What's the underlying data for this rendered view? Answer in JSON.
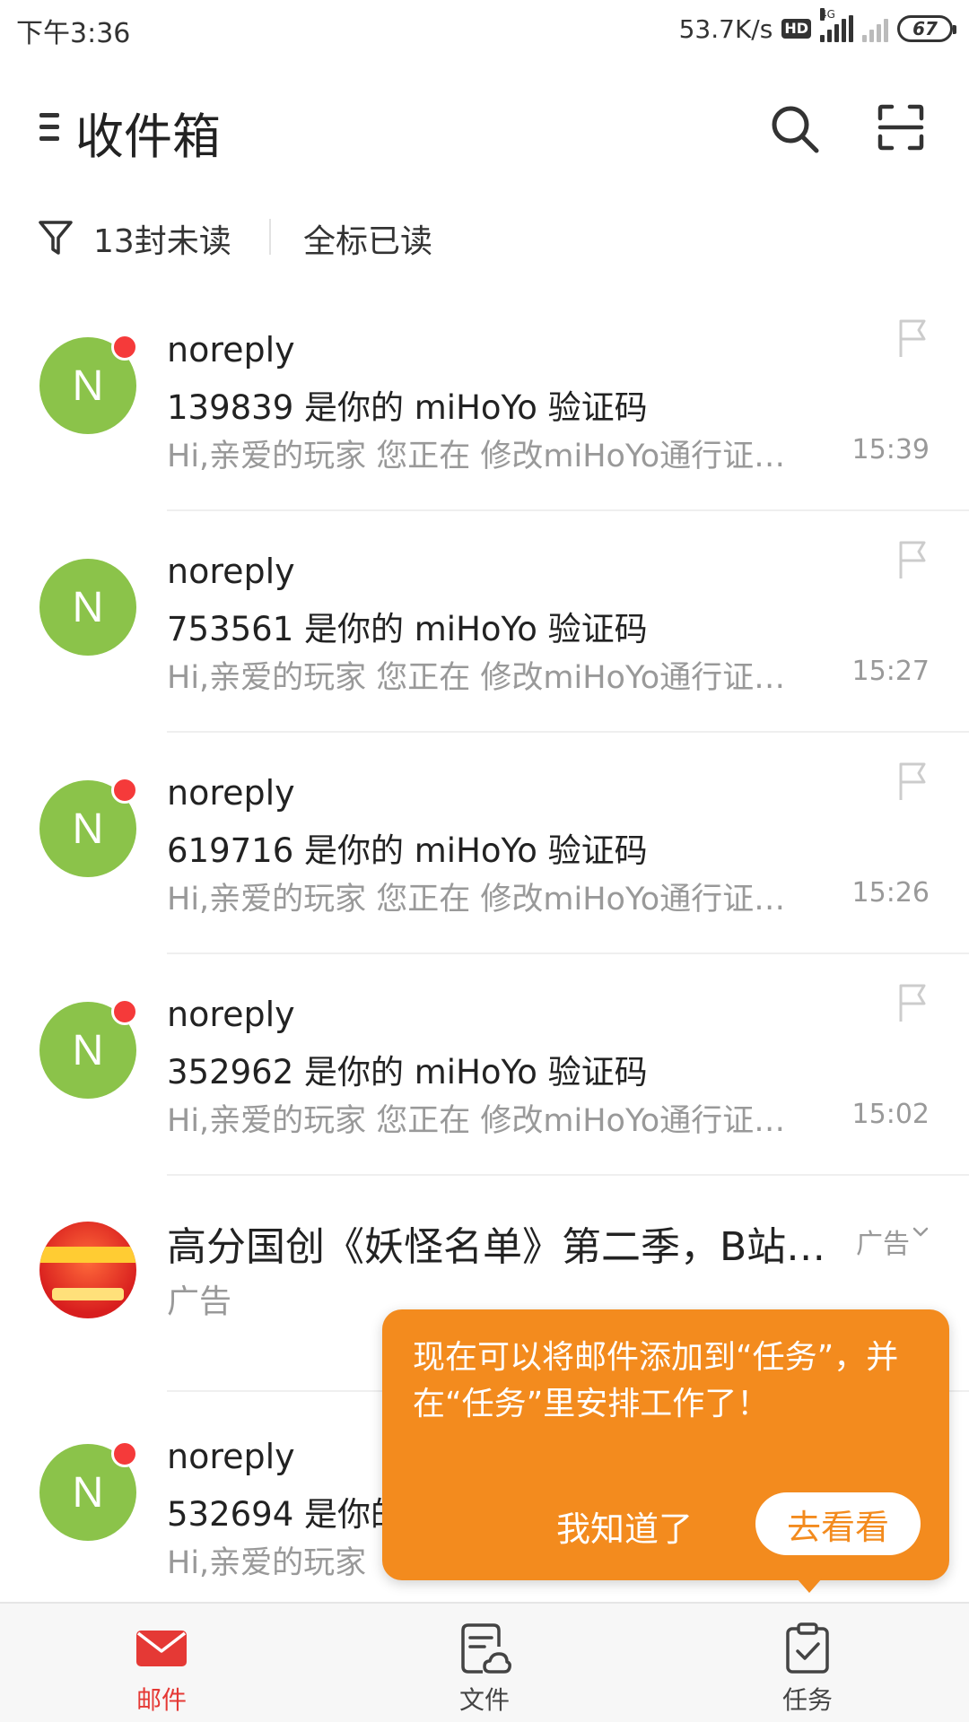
{
  "status_bar": {
    "time": "下午3:36",
    "net_speed": "53.7K/s",
    "hd_badge": "HD",
    "network_type": "4G",
    "battery": "67"
  },
  "header": {
    "title": "收件箱"
  },
  "filter_bar": {
    "unread_count": "13封未读",
    "mark_all_read": "全标已读"
  },
  "mails": [
    {
      "sender": "noreply",
      "subject": "139839 是你的 miHoYo 验证码",
      "preview": "Hi,亲爱的玩家 您正在 修改miHoYo通行证…",
      "time": "15:39",
      "unread": true
    },
    {
      "sender": "noreply",
      "subject": "753561 是你的 miHoYo 验证码",
      "preview": "Hi,亲爱的玩家 您正在 修改miHoYo通行证…",
      "time": "15:27",
      "unread": false
    },
    {
      "sender": "noreply",
      "subject": "619716 是你的 miHoYo 验证码",
      "preview": "Hi,亲爱的玩家 您正在 修改miHoYo通行证…",
      "time": "15:26",
      "unread": true
    },
    {
      "sender": "noreply",
      "subject": "352962 是你的 miHoYo 验证码",
      "preview": "Hi,亲爱的玩家 您正在 修改miHoYo通行证…",
      "time": "15:02",
      "unread": true
    }
  ],
  "ad": {
    "title": "高分国创《妖怪名单》第二季，B站…",
    "label_right": "广告",
    "label": "广告"
  },
  "last_mail": {
    "sender": "noreply",
    "subject": "532694 是你的",
    "preview": "Hi,亲爱的玩家",
    "avatar_letter": "N"
  },
  "avatar_letter": "N",
  "tooltip": {
    "text": "现在可以将邮件添加到“任务”，并在“任务”里安排工作了！",
    "dismiss": "我知道了",
    "go": "去看看"
  },
  "bottom_nav": [
    {
      "label": "邮件",
      "icon": "mail-icon",
      "active": true
    },
    {
      "label": "文件",
      "icon": "file-cloud-icon",
      "active": false
    },
    {
      "label": "任务",
      "icon": "task-icon",
      "active": false
    }
  ],
  "colors": {
    "accent": "#f38b1e",
    "active_tab": "#e53935",
    "avatar": "#8bc34a",
    "unread_dot": "#f53a3a"
  }
}
